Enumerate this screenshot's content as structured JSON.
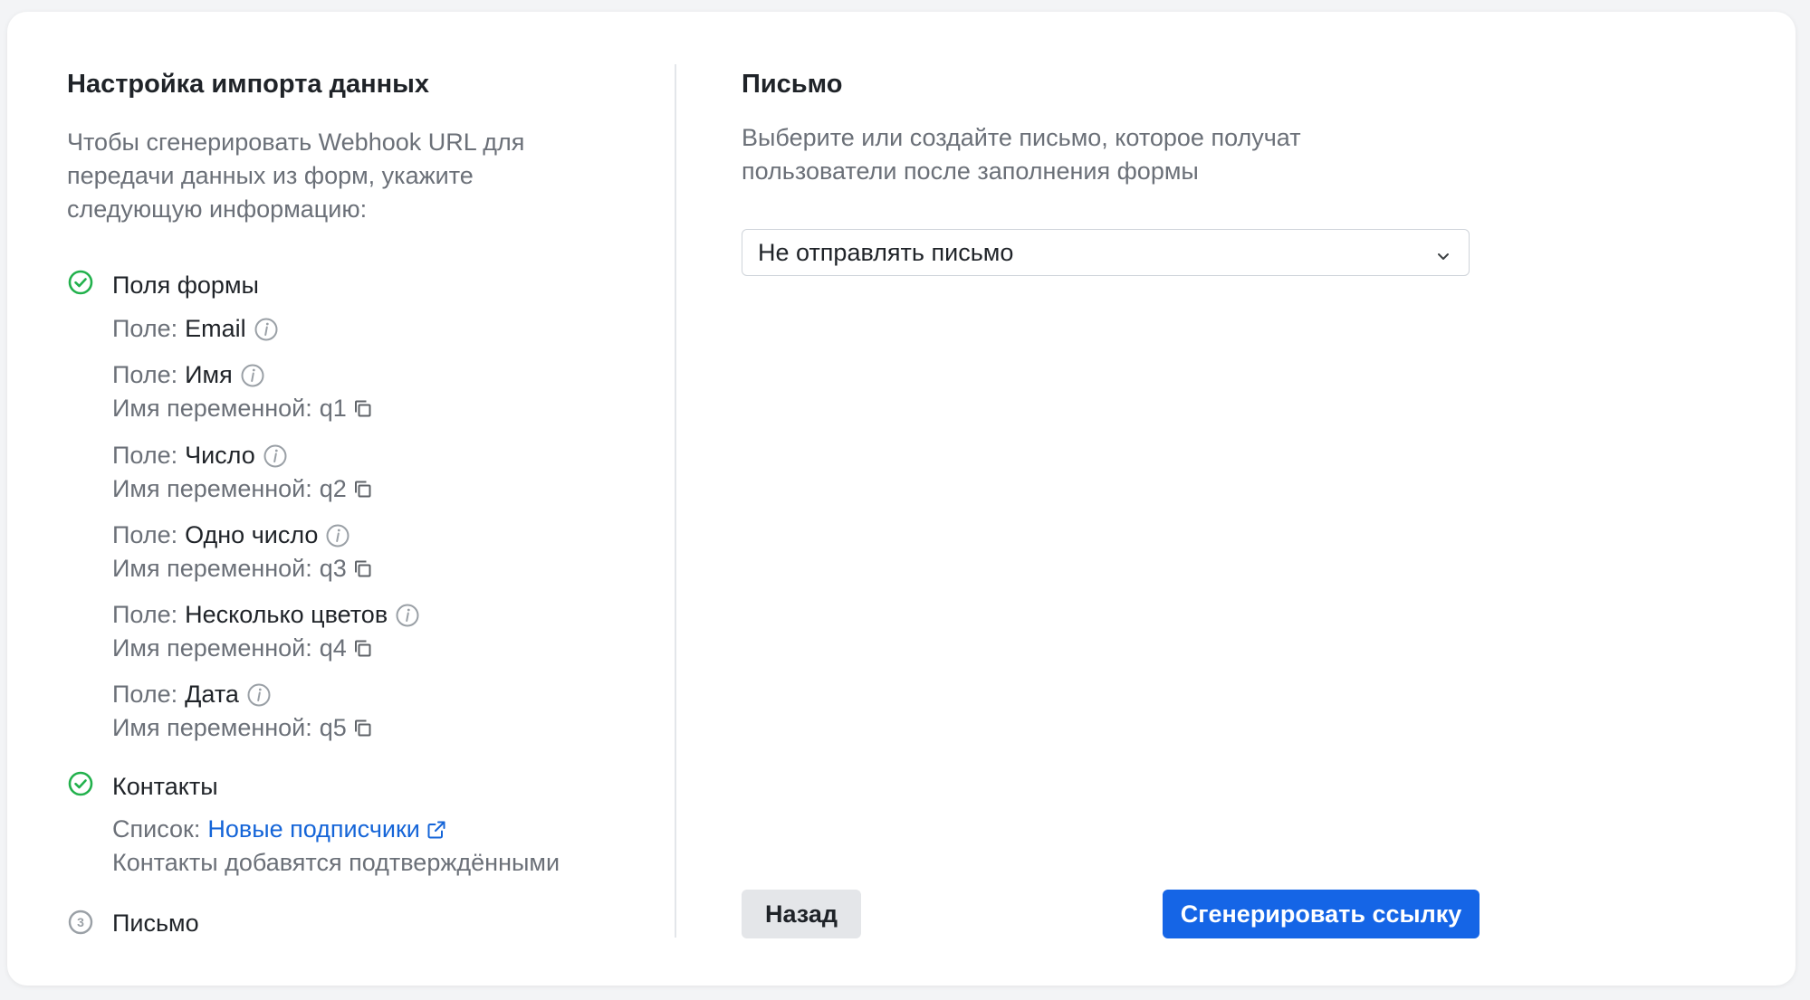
{
  "left": {
    "title": "Настройка импорта данных",
    "intro": "Чтобы сгенерировать Webhook URL для передачи данных из форм, укажите следующую информацию:",
    "step_form": {
      "label": "Поля формы",
      "field_prefix": "Поле:",
      "var_prefix": "Имя переменной:",
      "fields": [
        {
          "name": "Email",
          "var": ""
        },
        {
          "name": "Имя",
          "var": "q1"
        },
        {
          "name": "Число",
          "var": "q2"
        },
        {
          "name": "Одно число",
          "var": "q3"
        },
        {
          "name": "Несколько цветов",
          "var": "q4"
        },
        {
          "name": "Дата",
          "var": "q5"
        }
      ]
    },
    "step_contacts": {
      "label": "Контакты",
      "list_prefix": "Список:",
      "list_link": "Новые подписчики",
      "note": "Контакты добавятся подтверждёнными"
    },
    "step_letter": {
      "number": "3",
      "label": "Письмо"
    }
  },
  "right": {
    "title": "Письмо",
    "intro": "Выберите или создайте письмо, которое получат пользователи после заполнения формы",
    "select_value": "Не отправлять письмо",
    "back_label": "Назад",
    "generate_label": "Сгенерировать ссылку"
  },
  "colors": {
    "accent": "#1565e6",
    "link": "#1565d8",
    "success": "#22b14c",
    "muted": "#6b7078"
  }
}
